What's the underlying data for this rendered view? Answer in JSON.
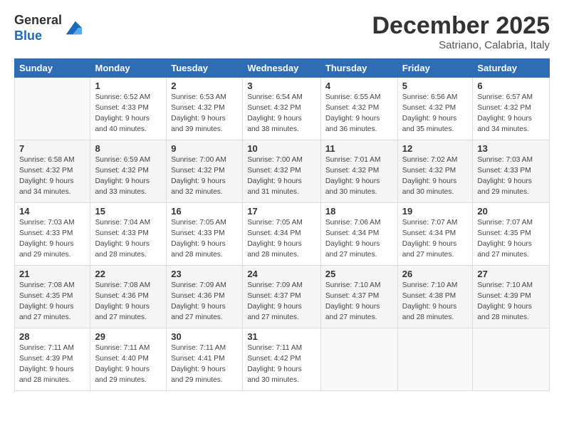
{
  "header": {
    "logo_line1": "General",
    "logo_line2": "Blue",
    "month": "December 2025",
    "location": "Satriano, Calabria, Italy"
  },
  "columns": [
    "Sunday",
    "Monday",
    "Tuesday",
    "Wednesday",
    "Thursday",
    "Friday",
    "Saturday"
  ],
  "weeks": [
    [
      {
        "day": "",
        "info": ""
      },
      {
        "day": "1",
        "info": "Sunrise: 6:52 AM\nSunset: 4:33 PM\nDaylight: 9 hours\nand 40 minutes."
      },
      {
        "day": "2",
        "info": "Sunrise: 6:53 AM\nSunset: 4:32 PM\nDaylight: 9 hours\nand 39 minutes."
      },
      {
        "day": "3",
        "info": "Sunrise: 6:54 AM\nSunset: 4:32 PM\nDaylight: 9 hours\nand 38 minutes."
      },
      {
        "day": "4",
        "info": "Sunrise: 6:55 AM\nSunset: 4:32 PM\nDaylight: 9 hours\nand 36 minutes."
      },
      {
        "day": "5",
        "info": "Sunrise: 6:56 AM\nSunset: 4:32 PM\nDaylight: 9 hours\nand 35 minutes."
      },
      {
        "day": "6",
        "info": "Sunrise: 6:57 AM\nSunset: 4:32 PM\nDaylight: 9 hours\nand 34 minutes."
      }
    ],
    [
      {
        "day": "7",
        "info": "Sunrise: 6:58 AM\nSunset: 4:32 PM\nDaylight: 9 hours\nand 34 minutes."
      },
      {
        "day": "8",
        "info": "Sunrise: 6:59 AM\nSunset: 4:32 PM\nDaylight: 9 hours\nand 33 minutes."
      },
      {
        "day": "9",
        "info": "Sunrise: 7:00 AM\nSunset: 4:32 PM\nDaylight: 9 hours\nand 32 minutes."
      },
      {
        "day": "10",
        "info": "Sunrise: 7:00 AM\nSunset: 4:32 PM\nDaylight: 9 hours\nand 31 minutes."
      },
      {
        "day": "11",
        "info": "Sunrise: 7:01 AM\nSunset: 4:32 PM\nDaylight: 9 hours\nand 30 minutes."
      },
      {
        "day": "12",
        "info": "Sunrise: 7:02 AM\nSunset: 4:32 PM\nDaylight: 9 hours\nand 30 minutes."
      },
      {
        "day": "13",
        "info": "Sunrise: 7:03 AM\nSunset: 4:33 PM\nDaylight: 9 hours\nand 29 minutes."
      }
    ],
    [
      {
        "day": "14",
        "info": "Sunrise: 7:03 AM\nSunset: 4:33 PM\nDaylight: 9 hours\nand 29 minutes."
      },
      {
        "day": "15",
        "info": "Sunrise: 7:04 AM\nSunset: 4:33 PM\nDaylight: 9 hours\nand 28 minutes."
      },
      {
        "day": "16",
        "info": "Sunrise: 7:05 AM\nSunset: 4:33 PM\nDaylight: 9 hours\nand 28 minutes."
      },
      {
        "day": "17",
        "info": "Sunrise: 7:05 AM\nSunset: 4:34 PM\nDaylight: 9 hours\nand 28 minutes."
      },
      {
        "day": "18",
        "info": "Sunrise: 7:06 AM\nSunset: 4:34 PM\nDaylight: 9 hours\nand 27 minutes."
      },
      {
        "day": "19",
        "info": "Sunrise: 7:07 AM\nSunset: 4:34 PM\nDaylight: 9 hours\nand 27 minutes."
      },
      {
        "day": "20",
        "info": "Sunrise: 7:07 AM\nSunset: 4:35 PM\nDaylight: 9 hours\nand 27 minutes."
      }
    ],
    [
      {
        "day": "21",
        "info": "Sunrise: 7:08 AM\nSunset: 4:35 PM\nDaylight: 9 hours\nand 27 minutes."
      },
      {
        "day": "22",
        "info": "Sunrise: 7:08 AM\nSunset: 4:36 PM\nDaylight: 9 hours\nand 27 minutes."
      },
      {
        "day": "23",
        "info": "Sunrise: 7:09 AM\nSunset: 4:36 PM\nDaylight: 9 hours\nand 27 minutes."
      },
      {
        "day": "24",
        "info": "Sunrise: 7:09 AM\nSunset: 4:37 PM\nDaylight: 9 hours\nand 27 minutes."
      },
      {
        "day": "25",
        "info": "Sunrise: 7:10 AM\nSunset: 4:37 PM\nDaylight: 9 hours\nand 27 minutes."
      },
      {
        "day": "26",
        "info": "Sunrise: 7:10 AM\nSunset: 4:38 PM\nDaylight: 9 hours\nand 28 minutes."
      },
      {
        "day": "27",
        "info": "Sunrise: 7:10 AM\nSunset: 4:39 PM\nDaylight: 9 hours\nand 28 minutes."
      }
    ],
    [
      {
        "day": "28",
        "info": "Sunrise: 7:11 AM\nSunset: 4:39 PM\nDaylight: 9 hours\nand 28 minutes."
      },
      {
        "day": "29",
        "info": "Sunrise: 7:11 AM\nSunset: 4:40 PM\nDaylight: 9 hours\nand 29 minutes."
      },
      {
        "day": "30",
        "info": "Sunrise: 7:11 AM\nSunset: 4:41 PM\nDaylight: 9 hours\nand 29 minutes."
      },
      {
        "day": "31",
        "info": "Sunrise: 7:11 AM\nSunset: 4:42 PM\nDaylight: 9 hours\nand 30 minutes."
      },
      {
        "day": "",
        "info": ""
      },
      {
        "day": "",
        "info": ""
      },
      {
        "day": "",
        "info": ""
      }
    ]
  ]
}
